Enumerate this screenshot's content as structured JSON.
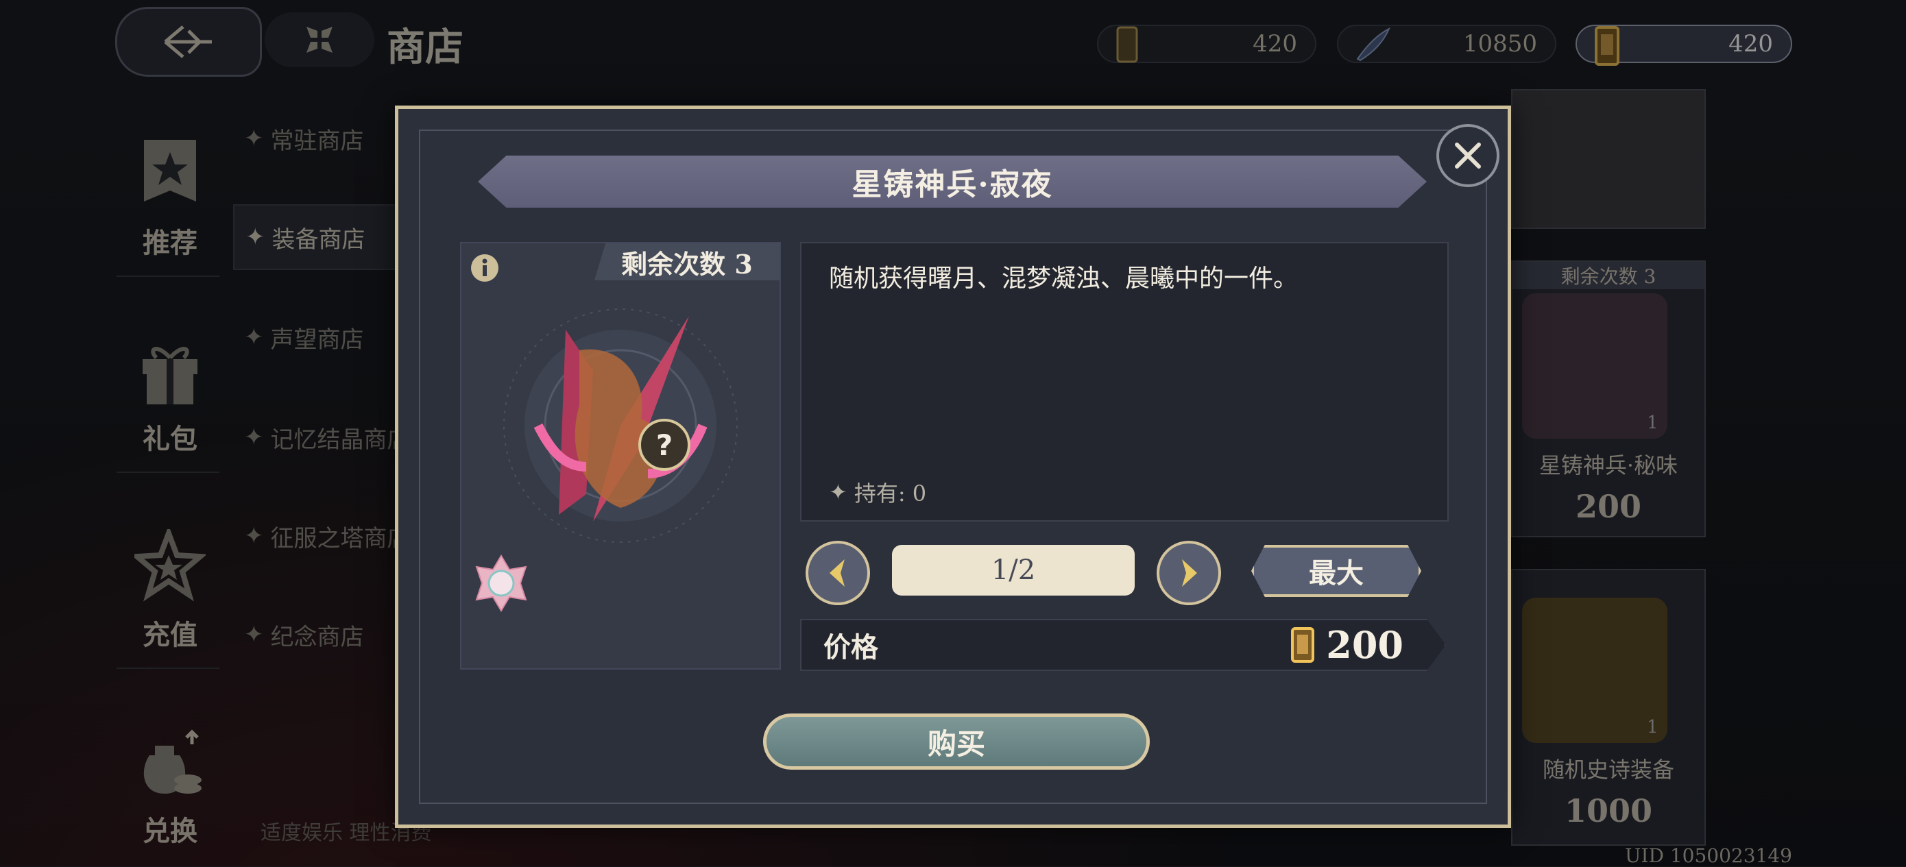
{
  "header": {
    "title": "商店",
    "currencies": [
      {
        "name": "ticket",
        "value": "420"
      },
      {
        "name": "feather",
        "value": "10850"
      },
      {
        "name": "ticket-gold",
        "value": "420"
      }
    ]
  },
  "left_nav": [
    {
      "label": "推荐",
      "icon": "banner-star-icon"
    },
    {
      "label": "礼包",
      "icon": "gift-icon"
    },
    {
      "label": "充值",
      "icon": "star-recharge-icon"
    },
    {
      "label": "兑换",
      "icon": "coin-bag-icon"
    }
  ],
  "sub_menu": [
    "常驻商店",
    "装备商店",
    "声望商店",
    "记忆结晶商店",
    "征服之塔商店",
    "纪念商店"
  ],
  "footnote": "适度娱乐 理性消费",
  "background_cards": [
    {
      "remain": "剩余次数 3",
      "name": "星铸神兵·秘味",
      "price": "200",
      "badge": "1"
    },
    {
      "name": "随机史诗装备",
      "price": "1000",
      "badge": "1"
    }
  ],
  "uid": "UID 1050023149",
  "modal": {
    "title": "星铸神兵·寂夜",
    "remaining": "剩余次数 3",
    "description": "随机获得曙月、混梦凝浊、晨曦中的一件。",
    "owned": "持有: 0",
    "quantity": "1/2",
    "max_label": "最大",
    "price_label": "价格",
    "price_value": "200",
    "buy_label": "购买"
  },
  "colors": {
    "frame_gold": "#cdbf9a",
    "buy_teal": "#6f8a8a",
    "modal_bg": "#2c303b",
    "item_pink": "#e0557e"
  }
}
